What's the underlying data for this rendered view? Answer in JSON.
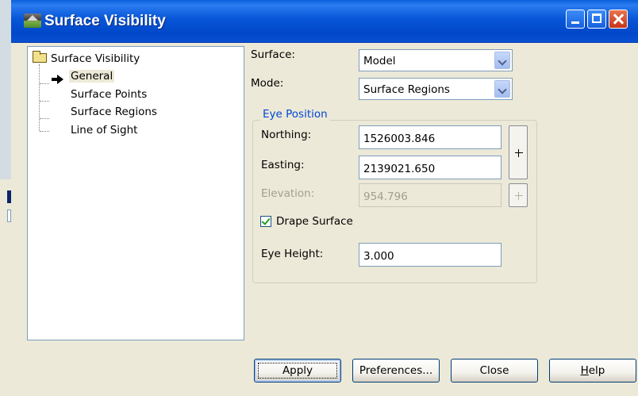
{
  "window": {
    "title": "Surface Visibility"
  },
  "tree": {
    "root": "Surface Visibility",
    "items": [
      "General",
      "Surface Points",
      "Surface Regions",
      "Line of Sight"
    ],
    "selected": "General"
  },
  "form": {
    "surface_label": "Surface:",
    "surface_value": "Model",
    "mode_label": "Mode:",
    "mode_value": "Surface Regions",
    "eye_position_title": "Eye Position",
    "northing_label": "Northing:",
    "northing_value": "1526003.846",
    "easting_label": "Easting:",
    "easting_value": "2139021.650",
    "elevation_label": "Elevation:",
    "elevation_value": "954.796",
    "drape_label": "Drape Surface",
    "drape_checked": true,
    "eye_height_label": "Eye Height:",
    "eye_height_value": "3.000"
  },
  "buttons": {
    "apply": "Apply",
    "preferences": "Preferences...",
    "close": "Close",
    "help_prefix": "H",
    "help_rest": "elp"
  }
}
